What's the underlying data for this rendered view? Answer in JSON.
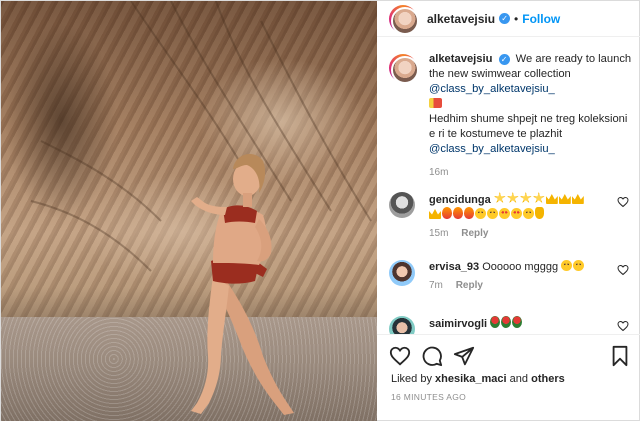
{
  "header": {
    "username": "alketavejsiu",
    "separator": "•",
    "follow_label": "Follow"
  },
  "caption": {
    "username": "alketavejsiu",
    "text_en": "We are ready to launch the new swimwear collection",
    "mention1": "@class_by_alketavejsiu_",
    "flag_icon": "flag-emoji",
    "text_sq": "Hedhim shume shpejt ne treg koleksioni e ri te kostumeve te plazhit",
    "mention2": "@class_by_alketavejsiu_",
    "time": "16m"
  },
  "comments": [
    {
      "username": "gencidunga",
      "emojis": [
        "star",
        "star",
        "star",
        "star",
        "crown",
        "crown",
        "crown",
        "crown",
        "fire",
        "fire",
        "fire",
        "face",
        "face",
        "heart-face",
        "heart-face",
        "face",
        "bag"
      ],
      "time": "15m",
      "reply": "Reply"
    },
    {
      "username": "ervisa_93",
      "text": "Oooooo mgggg",
      "emojis": [
        "face",
        "face"
      ],
      "time": "7m",
      "reply": "Reply"
    },
    {
      "username": "saimirvogli",
      "emojis": [
        "rose",
        "rose",
        "rose"
      ]
    }
  ],
  "likes": {
    "prefix": "Liked by",
    "liker": "xhesika_maci",
    "and": "and",
    "others": "others"
  },
  "timestamp": "16 MINUTES AGO",
  "colors": {
    "link_blue": "#0095f6",
    "verified_blue": "#3897f0",
    "meta_gray": "#8e8e8e"
  }
}
